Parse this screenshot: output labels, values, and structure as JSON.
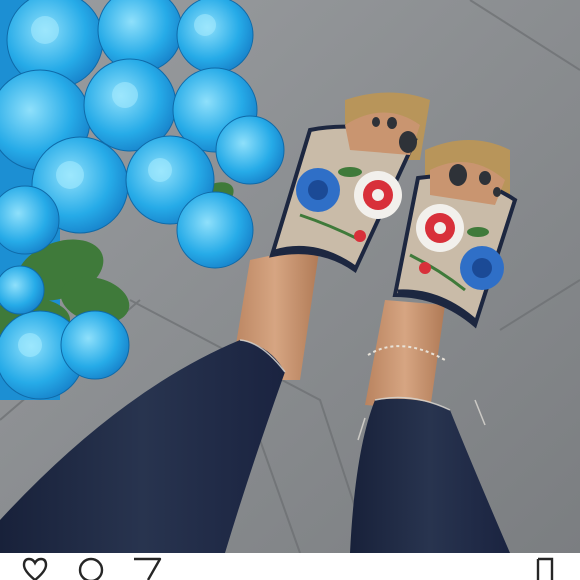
{
  "photo": {
    "subject": "embroidered-espadrille-slides",
    "colors": {
      "pavement": "#8c8f92",
      "pavement_dark": "#74787b",
      "flowers": "#1fa6e6",
      "flowers_light": "#6fd0f7",
      "leaves": "#3f7a3a",
      "jeans": "#202b44",
      "skin": "#c99570",
      "strap": "#c8b9a6",
      "jute": "#b8955a",
      "polish": "#2e3238",
      "embroidery_blue": "#2f6fc7",
      "embroidery_red": "#d8303a"
    }
  },
  "action_bar": {
    "icons": [
      "heart-icon",
      "comment-icon",
      "share-icon",
      "bookmark-icon"
    ]
  }
}
